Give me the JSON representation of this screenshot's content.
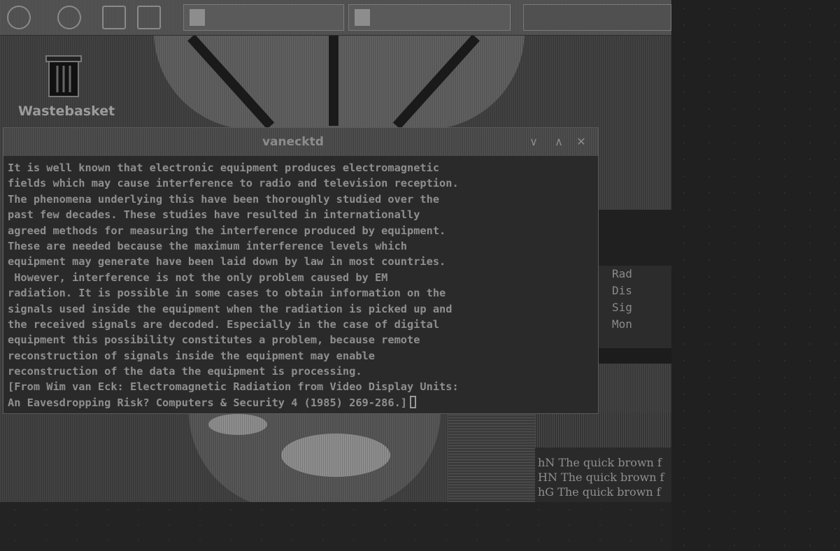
{
  "desktop": {
    "trash_label": "Wastebasket",
    "trash_icon": "trash-can-icon"
  },
  "top_panel": {
    "launcher_icons": [
      "gear-icon",
      "settings-icon",
      "document-icon"
    ],
    "tasks": [
      {
        "label": "",
        "icon": "app-icon"
      },
      {
        "label": "",
        "icon": "terminal-icon"
      }
    ]
  },
  "xterm": {
    "title": "vanecktd",
    "controls": {
      "minimize": "∨",
      "maximize": "∧",
      "close": "✕"
    },
    "lines": [
      "It is well known that electronic equipment produces electromagnetic",
      "fields which may cause interference to radio and television reception.",
      "The phenomena underlying this have been thoroughly studied over the",
      "past few decades. These studies have resulted in internationally",
      "agreed methods for measuring the interference produced by equipment.",
      "These are needed because the maximum interference levels which",
      "equipment may generate have been laid down by law in most countries.",
      " However, interference is not the only problem caused by EM",
      "radiation. It is possible in some cases to obtain information on the",
      "signals used inside the equipment when the radiation is picked up and",
      "the received signals are decoded. Especially in the case of digital",
      "equipment this possibility constitutes a problem, because remote",
      "reconstruction of signals inside the equipment may enable",
      "reconstruction of the data the equipment is processing.",
      "[From Wim van Eck: Electromagnetic Radiation from Video Display Units:",
      "An Eavesdropping Risk? Computers & Security 4 (1985) 269-286.]"
    ]
  },
  "background_window": {
    "rows": [
      "Rad",
      "Dis",
      "Sig",
      "Mon"
    ]
  },
  "background_terminal": {
    "rows": [
      "hN The quick brown f",
      "HN The quick brown f",
      "hG The quick brown f"
    ]
  },
  "colors": {
    "screen_bg": "#1f1f1f",
    "desktop": "#3a3a3a",
    "terminal_bg": "#2a2a2a",
    "text": "#8f8f8f"
  }
}
